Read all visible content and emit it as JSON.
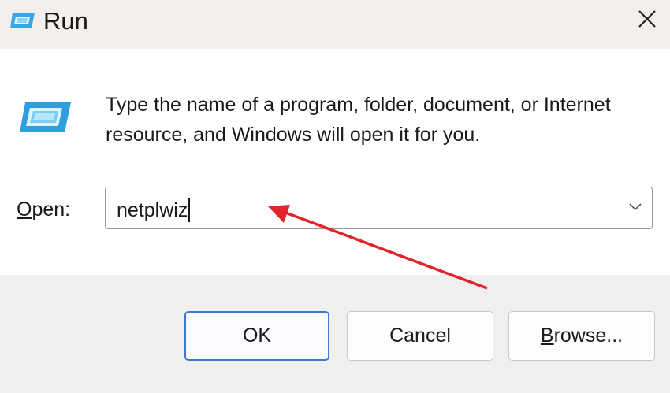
{
  "window": {
    "title": "Run",
    "close_icon": "close-icon",
    "title_icon": "run-app-icon"
  },
  "main": {
    "icon": "run-app-icon",
    "description": "Type the name of a program, folder, document, or Internet resource, and Windows will open it for you."
  },
  "open_field": {
    "label": "Open:",
    "value": "netplwiz",
    "dropdown_icon": "chevron-down-icon"
  },
  "buttons": {
    "ok": "OK",
    "cancel": "Cancel",
    "browse": "Browse..."
  },
  "annotation": {
    "type": "red-arrow",
    "color": "#e0262b"
  }
}
